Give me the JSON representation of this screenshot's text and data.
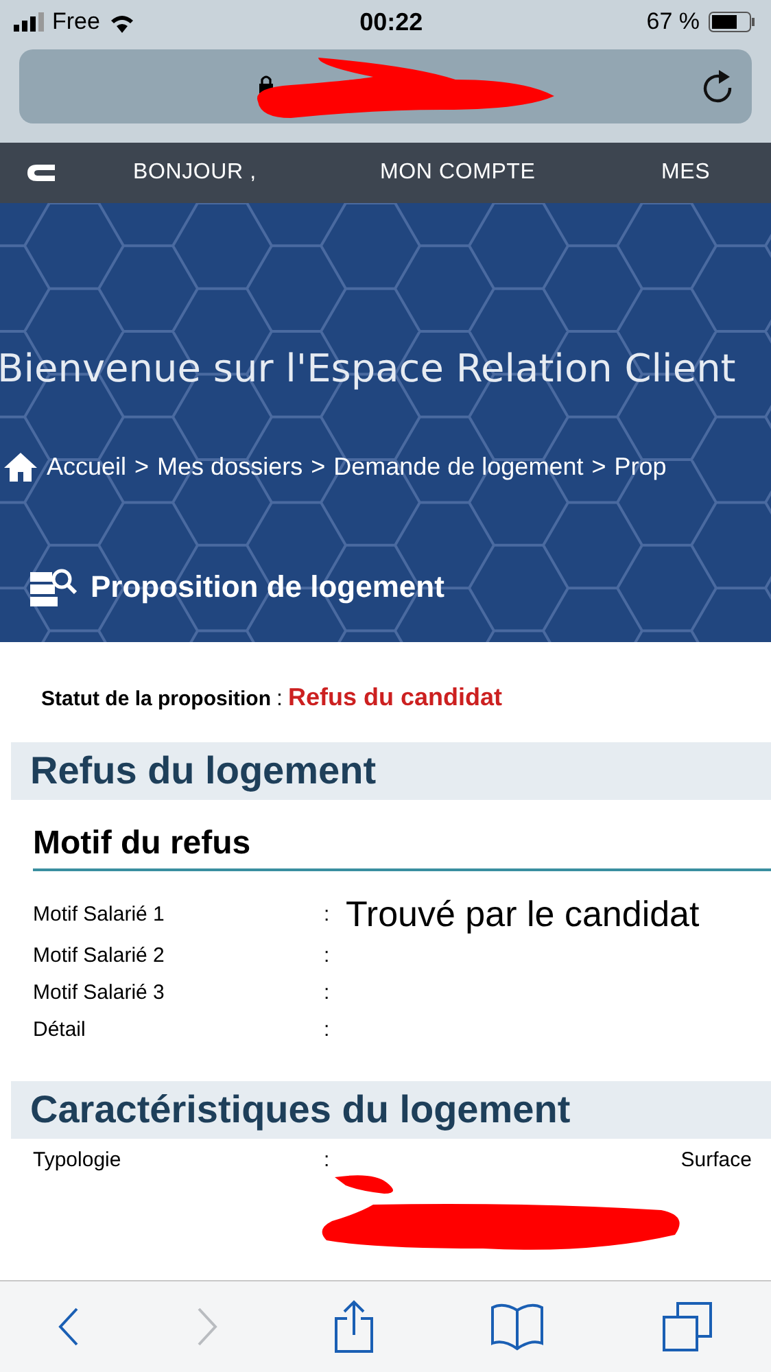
{
  "status_bar": {
    "carrier": "Free",
    "time": "00:22",
    "battery": "67 %"
  },
  "nav": {
    "items": [
      "BONJOUR ,",
      "MON COMPTE",
      "MES"
    ]
  },
  "hero": {
    "title": "Bienvenue sur l'Espace Relation Client",
    "breadcrumb": [
      "Accueil",
      "Mes dossiers",
      "Demande de logement",
      "Prop"
    ],
    "separator": ">",
    "section_title": "Proposition de logement"
  },
  "proposal_status": {
    "label": "Statut de la proposition",
    "separator": ":",
    "value": "Refus du candidat"
  },
  "sections": [
    {
      "title": "Refus du logement",
      "subtitle": "Motif du refus",
      "fields": [
        {
          "label": "Motif Salarié 1",
          "separator": ":",
          "value": "Trouvé par le candidat"
        },
        {
          "label": "Motif Salarié 2",
          "separator": ":"
        },
        {
          "label": "Motif Salarié 3",
          "separator": ":"
        },
        {
          "label": "Détail",
          "separator": ":"
        }
      ]
    },
    {
      "title": "Caractéristiques du logement",
      "fields": [
        {
          "label": "Typologie",
          "separator": ":",
          "extra_label": "Surface"
        }
      ]
    }
  ],
  "toolbar": [
    {
      "kind": "back",
      "disabled": false
    },
    {
      "kind": "forward",
      "disabled": true
    },
    {
      "kind": "share",
      "disabled": false
    },
    {
      "kind": "bookmarks",
      "disabled": false
    },
    {
      "kind": "tabs",
      "disabled": false
    }
  ]
}
